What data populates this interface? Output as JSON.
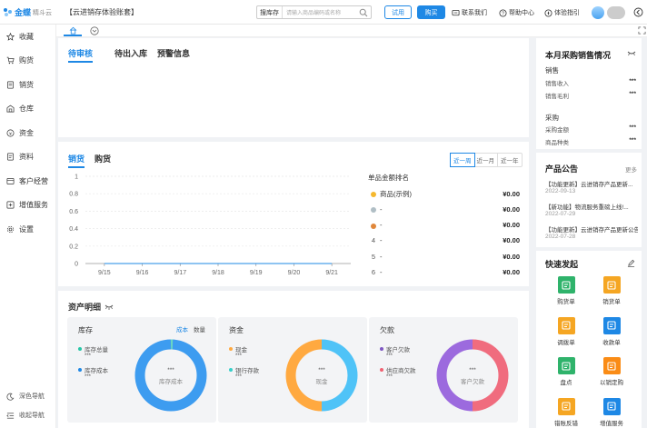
{
  "app": {
    "logo_text": "金蝶",
    "logo_sub": "精斗云",
    "account_name": "【云进销存体验账套】"
  },
  "search": {
    "label": "搜库存",
    "placeholder": "请输入商品编码或名称"
  },
  "header": {
    "try_label": "试用",
    "buy_label": "购买",
    "contact_label": "联系我们",
    "help_label": "帮助中心",
    "guide_label": "体验指引"
  },
  "sidebar": {
    "items": [
      {
        "label": "收藏",
        "icon": "star-icon"
      },
      {
        "label": "购货",
        "icon": "cart-icon"
      },
      {
        "label": "销货",
        "icon": "sales-icon"
      },
      {
        "label": "仓库",
        "icon": "warehouse-icon"
      },
      {
        "label": "资金",
        "icon": "money-icon"
      },
      {
        "label": "资料",
        "icon": "document-icon"
      },
      {
        "label": "客户经营",
        "icon": "customer-icon"
      },
      {
        "label": "增值服务",
        "icon": "service-icon"
      },
      {
        "label": "设置",
        "icon": "gear-icon"
      }
    ],
    "bottom": [
      {
        "label": "深色导航",
        "icon": "theme-icon"
      },
      {
        "label": "收起导航",
        "icon": "collapse-icon"
      }
    ]
  },
  "tasks": {
    "tabs": [
      "待审核",
      "待出入库",
      "预警信息"
    ]
  },
  "trend": {
    "tabs": [
      "销货",
      "购货"
    ],
    "ranges": [
      "近一周",
      "近一月",
      "近一年"
    ],
    "selected_range": "近一周",
    "rank_title": "单品金额排名",
    "rank": [
      {
        "no": "1",
        "name": "商品(示例)",
        "value": "¥0.00",
        "medal": "gold"
      },
      {
        "no": "2",
        "name": "-",
        "value": "¥0.00",
        "medal": "silver"
      },
      {
        "no": "3",
        "name": "-",
        "value": "¥0.00",
        "medal": "bronze"
      },
      {
        "no": "4",
        "name": "-",
        "value": "¥0.00"
      },
      {
        "no": "5",
        "name": "-",
        "value": "¥0.00"
      },
      {
        "no": "6",
        "name": "-",
        "value": "¥0.00"
      }
    ]
  },
  "chart_data": {
    "type": "line",
    "categories": [
      "9/15",
      "9/16",
      "9/17",
      "9/18",
      "9/19",
      "9/20",
      "9/21"
    ],
    "series": [
      {
        "values": [
          0,
          0,
          0,
          0,
          0,
          0,
          0
        ]
      }
    ],
    "ylim": [
      0,
      1
    ],
    "yticks": [
      "0",
      "0.2",
      "0.4",
      "0.6",
      "0.8",
      "1"
    ],
    "title": "",
    "xlabel": "",
    "ylabel": "",
    "grid": true
  },
  "assets": {
    "title": "资产明细",
    "inventory": {
      "title": "库存",
      "toggle": [
        "成本",
        "数量"
      ],
      "legend": [
        {
          "label": "库存总量",
          "value": "***",
          "color": "#26c6a6"
        },
        {
          "label": "库存成本",
          "value": "***",
          "color": "#1e88e5"
        }
      ],
      "donut_value": "***",
      "donut_label": "库存成本",
      "colors": [
        "#3d9cf0",
        "#6ad6c2"
      ]
    },
    "funds": {
      "title": "资金",
      "legend": [
        {
          "label": "现金",
          "value": "***",
          "color": "#ffa940"
        },
        {
          "label": "银行存款",
          "value": "***",
          "color": "#36cfc9"
        }
      ],
      "donut_value": "***",
      "donut_label": "现金",
      "colors": [
        "#ffa940",
        "#4fc3f7"
      ]
    },
    "debts": {
      "title": "欠款",
      "legend": [
        {
          "label": "客户欠款",
          "value": "***",
          "color": "#7e57c2"
        },
        {
          "label": "供应商欠款",
          "value": "***",
          "color": "#f06272"
        }
      ],
      "donut_value": "***",
      "donut_label": "客户欠款",
      "colors": [
        "#f06c7e",
        "#9c6ade"
      ]
    }
  },
  "monthly": {
    "title": "本月采购销售情况",
    "sales_label": "销售",
    "sales": [
      {
        "label": "销售收入",
        "value": "***"
      },
      {
        "label": "销售毛利",
        "value": "***"
      }
    ],
    "purchase_label": "采购",
    "purchase": [
      {
        "label": "采购金额",
        "value": "***"
      },
      {
        "label": "商品种类",
        "value": "***"
      }
    ]
  },
  "announcements": {
    "title": "产品公告",
    "more": "更多",
    "items": [
      {
        "text": "【功能更新】云进销存产品更新...",
        "date": "2022-09-13"
      },
      {
        "text": "【新功能】物流服务重磅上线!...",
        "date": "2022-07-29"
      },
      {
        "text": "【功能更新】云进销存产品更新公告",
        "date": "2022-07-28"
      }
    ]
  },
  "quick": {
    "title": "快速发起",
    "items": [
      {
        "label": "购货单",
        "color": "#2fb36b",
        "icon": "purchase-order-icon"
      },
      {
        "label": "销货单",
        "color": "#f5a623",
        "icon": "sales-order-icon"
      },
      {
        "label": "调拨单",
        "color": "#f5a623",
        "icon": "transfer-icon"
      },
      {
        "label": "收款单",
        "color": "#1e88e5",
        "icon": "receipt-icon"
      },
      {
        "label": "盘点",
        "color": "#2fb36b",
        "icon": "stocktake-icon"
      },
      {
        "label": "以销定购",
        "color": "#fa8c16",
        "icon": "sell-to-buy-icon"
      },
      {
        "label": "错账反错账",
        "color": "#f5a623",
        "icon": "reverse-icon"
      },
      {
        "label": "增值服务",
        "color": "#1e88e5",
        "icon": "service-icon"
      }
    ]
  }
}
